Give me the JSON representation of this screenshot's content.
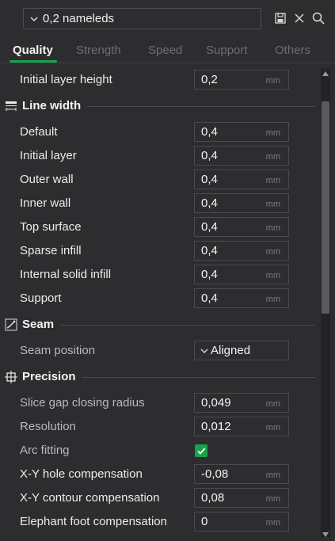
{
  "preset": {
    "value": "0,2 nameleds"
  },
  "tabs": [
    {
      "label": "Quality",
      "active": true
    },
    {
      "label": "Strength",
      "active": false
    },
    {
      "label": "Speed",
      "active": false
    },
    {
      "label": "Support",
      "active": false
    },
    {
      "label": "Others",
      "active": false
    }
  ],
  "rows": {
    "initial_layer_height": {
      "label": "Initial layer height",
      "value": "0,2",
      "unit": "mm"
    },
    "line_width": {
      "title": "Line width",
      "default": {
        "label": "Default",
        "value": "0,4",
        "unit": "mm"
      },
      "initial_layer": {
        "label": "Initial layer",
        "value": "0,4",
        "unit": "mm"
      },
      "outer_wall": {
        "label": "Outer wall",
        "value": "0,4",
        "unit": "mm"
      },
      "inner_wall": {
        "label": "Inner wall",
        "value": "0,4",
        "unit": "mm"
      },
      "top_surface": {
        "label": "Top surface",
        "value": "0,4",
        "unit": "mm"
      },
      "sparse_infill": {
        "label": "Sparse infill",
        "value": "0,4",
        "unit": "mm"
      },
      "internal_solid_infill": {
        "label": "Internal solid infill",
        "value": "0,4",
        "unit": "mm"
      },
      "support": {
        "label": "Support",
        "value": "0,4",
        "unit": "mm"
      }
    },
    "seam": {
      "title": "Seam",
      "position": {
        "label": "Seam position",
        "value": "Aligned"
      }
    },
    "precision": {
      "title": "Precision",
      "slice_gap": {
        "label": "Slice gap closing radius",
        "value": "0,049",
        "unit": "mm"
      },
      "resolution": {
        "label": "Resolution",
        "value": "0,012",
        "unit": "mm"
      },
      "arc_fitting": {
        "label": "Arc fitting",
        "checked": true
      },
      "xy_hole": {
        "label": "X-Y hole compensation",
        "value": "-0,08",
        "unit": "mm"
      },
      "xy_contour": {
        "label": "X-Y contour compensation",
        "value": "0,08",
        "unit": "mm"
      },
      "elephant_foot": {
        "label": "Elephant foot compensation",
        "value": "0",
        "unit": "mm"
      }
    }
  },
  "colors": {
    "accent": "#16a34a",
    "background": "#2d2d30"
  },
  "icons": [
    "chevron-down-icon",
    "save-icon",
    "close-icon",
    "search-icon",
    "line-width-icon",
    "seam-icon",
    "precision-icon",
    "checkmark-icon"
  ]
}
